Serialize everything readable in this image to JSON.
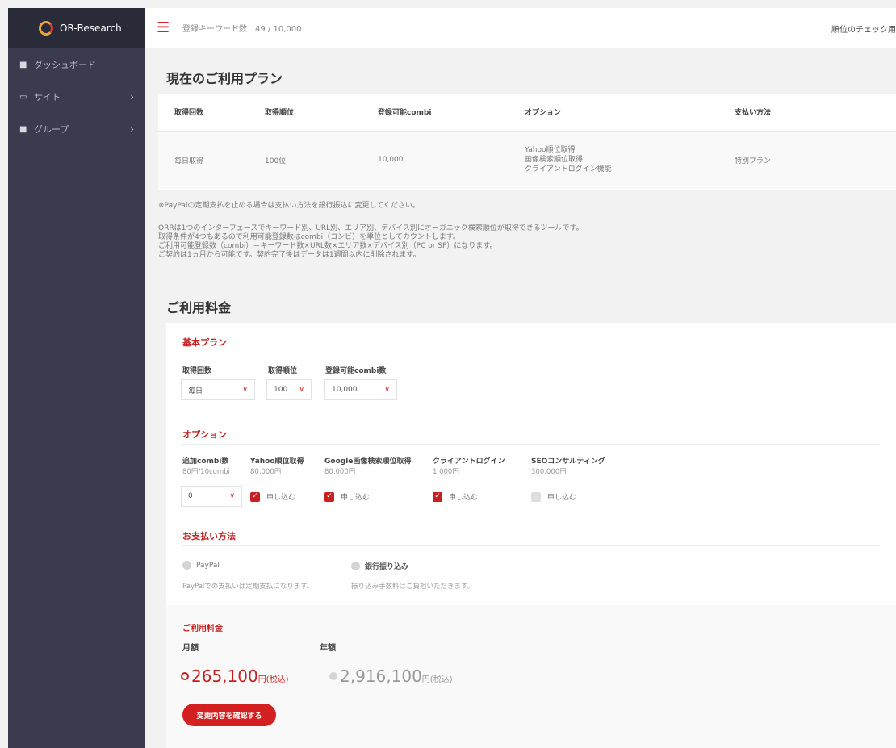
{
  "app": {
    "brand": "OR-Research"
  },
  "sidebar": {
    "items": [
      {
        "label": "ダッシュボード"
      },
      {
        "label": "サイト",
        "chevron": "›"
      },
      {
        "label": "グループ",
        "chevron": "›"
      }
    ]
  },
  "topbar": {
    "keyword_count": "登録キーワード数：49 / 10,000",
    "check_link": "順位のチェック用"
  },
  "current_plan": {
    "title": "現在のご利用プラン",
    "headers": [
      "取得回数",
      "取得順位",
      "登録可能combi",
      "オプション",
      "支払い方法"
    ],
    "row": {
      "frequency": "毎日取得",
      "rank": "100位",
      "combi": "10,000",
      "options": [
        "Yahoo順位取得",
        "画像検索順位取得",
        "クライアントログイン機能"
      ],
      "payment": "特別プラン"
    }
  },
  "notes": {
    "paypal": "※PayPalの定期支払を止める場合は支払い方法を銀行振込に変更してください。",
    "lines": [
      "ORRは1つのインターフェースでキーワード別、URL別、エリア別、デバイス別にオーガニック検索順位が取得できるツールです。",
      "取得条件が4つもあるので利用可能登録数はcombi（コンビ）を単位としてカウントします。",
      "ご利用可能登録数（combi）＝キーワード数×URL数×エリア数×デバイス別（PC or SP）になります。",
      "ご契約は1ヵ月から可能です。契約完了後はデータは1週間以内に削除されます。"
    ]
  },
  "pricing": {
    "title": "ご利用料金",
    "basic": {
      "heading": "基本プラン",
      "fields": [
        {
          "label": "取得回数",
          "value": "毎日"
        },
        {
          "label": "取得順位",
          "value": "100"
        },
        {
          "label": "登録可能combi数",
          "value": "10,000"
        }
      ]
    },
    "options": {
      "heading": "オプション",
      "extra_combi": {
        "label": "追加combi数",
        "price": "80円/10combi",
        "value": "0"
      },
      "items": [
        {
          "label": "Yahoo順位取得",
          "price": "80,000円",
          "apply": "申し込む",
          "checked": true
        },
        {
          "label": "Google画像検索順位取得",
          "price": "80,000円",
          "apply": "申し込む",
          "checked": true
        },
        {
          "label": "クライアントログイン",
          "price": "1,000円",
          "apply": "申し込む",
          "checked": true
        },
        {
          "label": "SEOコンサルティング",
          "price": "300,000円",
          "apply": "申し込む",
          "checked": false
        }
      ]
    },
    "payment": {
      "heading": "お支払い方法",
      "paypal": {
        "label": "PayPal",
        "note": "PayPalでの支払いは定期支払になります。"
      },
      "bank": {
        "label": "銀行振り込み",
        "note": "振り込み手数料はご負担いただきます。"
      }
    },
    "fee": {
      "heading": "ご利用料金",
      "monthly_label": "月額",
      "yearly_label": "年額",
      "monthly_amount": "265,100",
      "yearly_amount": "2,916,100",
      "unit": "円(税込)"
    },
    "confirm_button": "変更内容を確認する"
  },
  "colors": {
    "accent": "#d42020",
    "sidebar": "#3a3b4d",
    "brand_bar": "#2a2b38"
  },
  "icons": {
    "menu": "hamburger-icon",
    "dropdown": "chevron-down-icon",
    "home": "home-icon",
    "site": "window-icon",
    "group": "folder-icon"
  }
}
